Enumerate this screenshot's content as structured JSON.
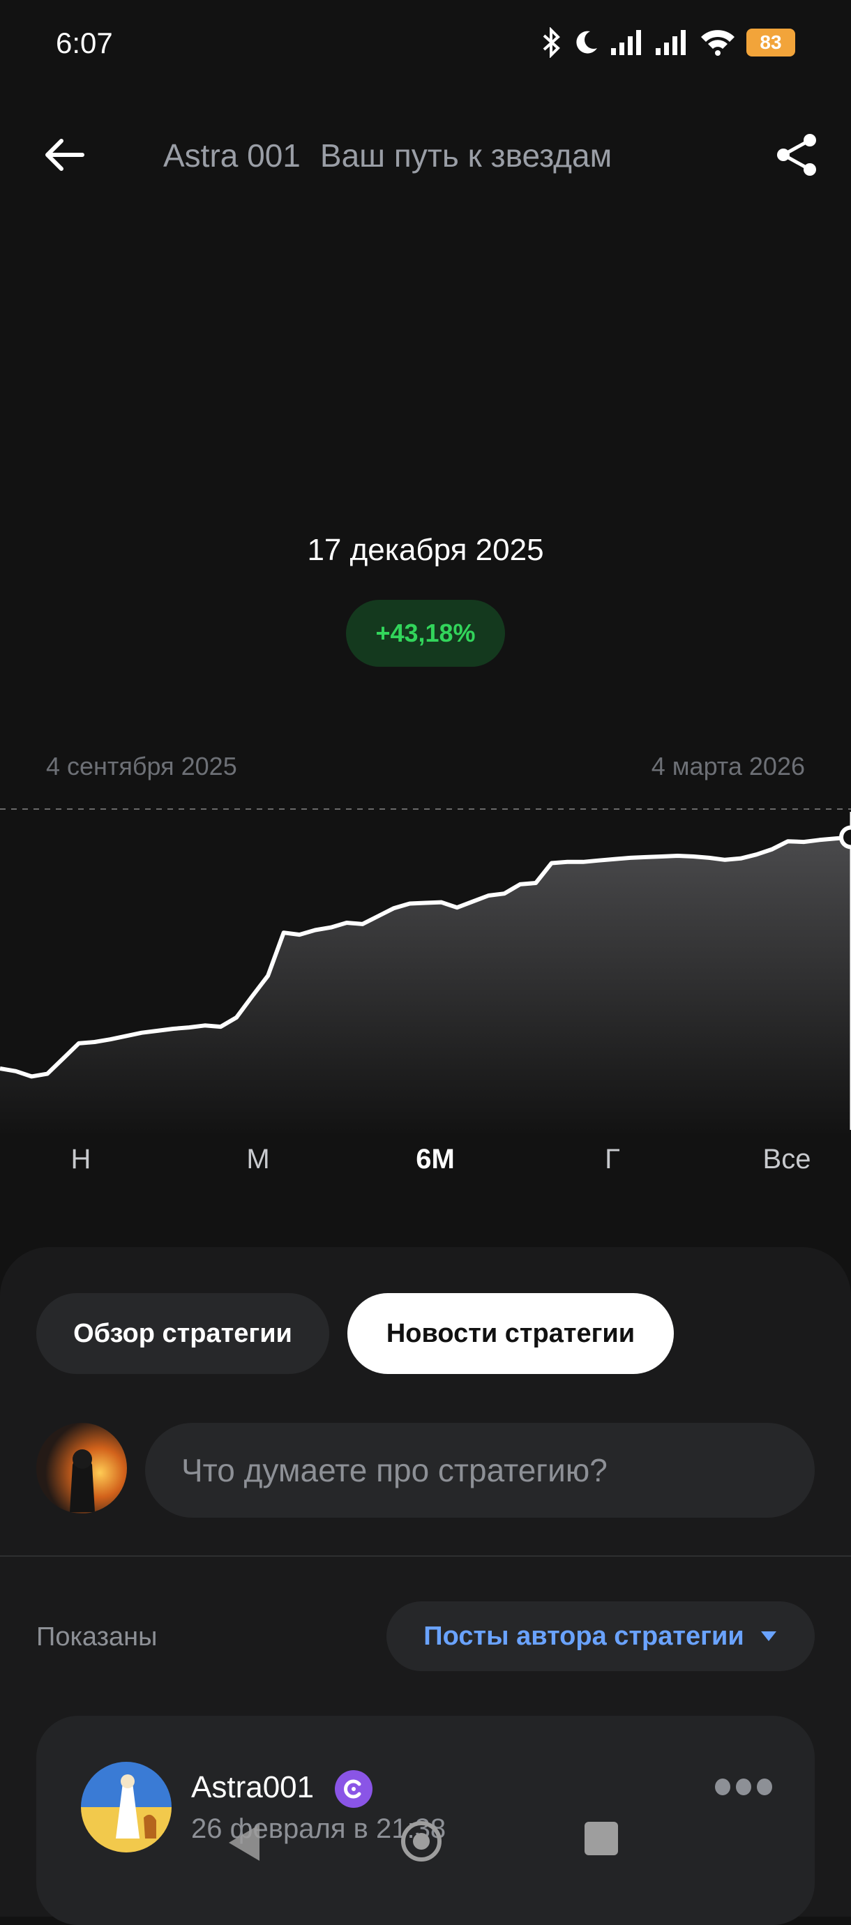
{
  "status_bar": {
    "time": "6:07",
    "battery": "83",
    "icons": [
      "bluetooth-icon",
      "moon-icon",
      "signal-icon",
      "signal-icon",
      "wifi-icon",
      "battery-icon"
    ]
  },
  "header": {
    "strategy_code": "Astra 001",
    "strategy_name": "Ваш путь к звездам"
  },
  "chart": {
    "tooltip_date": "17 декабря 2025",
    "tooltip_change": "+43,18%",
    "range_start": "4 сентября 2025",
    "range_end": "4 марта 2026"
  },
  "chart_data": {
    "type": "area",
    "x_range": [
      "4 сентября 2025",
      "4 марта 2026"
    ],
    "selected_index": 54,
    "values": [
      12.0,
      11.6,
      10.8,
      11.2,
      13.5,
      15.8,
      16.0,
      16.4,
      16.9,
      17.4,
      17.7,
      18.0,
      18.2,
      18.5,
      18.3,
      19.7,
      22.9,
      26.0,
      32.5,
      32.2,
      32.9,
      33.3,
      34.0,
      33.8,
      35.0,
      36.2,
      36.9,
      37.0,
      37.1,
      36.3,
      37.2,
      38.1,
      38.4,
      39.8,
      40.0,
      43.0,
      43.18,
      43.18,
      43.4,
      43.6,
      43.8,
      43.9,
      44.0,
      44.1,
      44.0,
      43.8,
      43.5,
      43.7,
      44.3,
      45.1,
      46.3,
      46.2,
      46.5,
      46.7,
      46.9
    ]
  },
  "periods": [
    {
      "label": "Н"
    },
    {
      "label": "М"
    },
    {
      "label": "6М"
    },
    {
      "label": "Г"
    },
    {
      "label": "Все"
    }
  ],
  "tabs": {
    "overview": "Обзор стратегии",
    "news": "Новости стратегии"
  },
  "comment": {
    "placeholder": "Что думаете про стратегию?"
  },
  "filter": {
    "shown_label": "Показаны",
    "selected": "Посты автора стратегии"
  },
  "post": {
    "author": "Astra001",
    "date": "26 февраля в 21:38"
  },
  "colors": {
    "background": "#121212",
    "positive": "#32d55b",
    "link": "#6aa3ff",
    "badge": "#8a55e6"
  }
}
